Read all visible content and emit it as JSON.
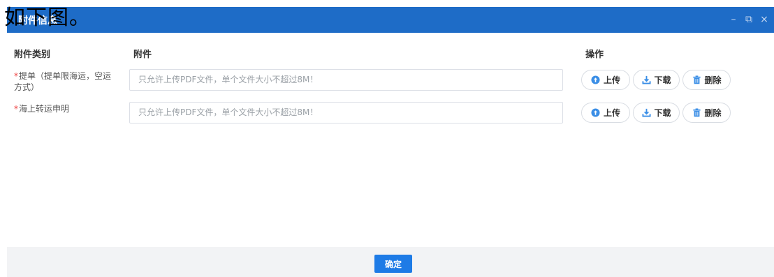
{
  "dialog": {
    "title": "附件信息",
    "overlay_text": "如下图。",
    "window_controls": {
      "minimize": "–",
      "maximize": "⧉",
      "close": "×"
    }
  },
  "table": {
    "headers": {
      "category": "附件类别",
      "attachment": "附件",
      "actions": "操作"
    },
    "rows": [
      {
        "required_mark": "*",
        "label": "提单（提单限海运，空运方式）",
        "placeholder": "只允许上传PDF文件，单个文件大小不超过8M！"
      },
      {
        "required_mark": "*",
        "label": "海上转运申明",
        "placeholder": "只允许上传PDF文件，单个文件大小不超过8M！"
      }
    ],
    "actions": {
      "upload": "上传",
      "download": "下载",
      "delete": "删除"
    }
  },
  "footer": {
    "confirm_label": "确定"
  },
  "colors": {
    "titlebar": "#1e6cc7",
    "primary_button": "#1e7be6",
    "required": "#e44444",
    "icon_blue": "#3a8ee6"
  }
}
